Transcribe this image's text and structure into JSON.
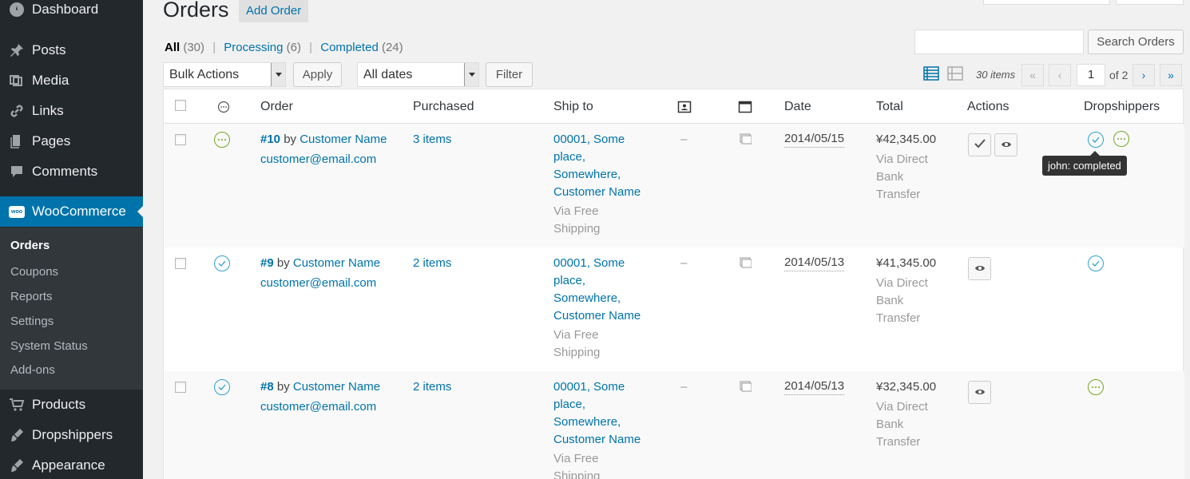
{
  "sidebar": {
    "items": [
      {
        "label": "Dashboard",
        "icon": "dashboard-icon"
      },
      {
        "label": "Posts",
        "icon": "pin-icon"
      },
      {
        "label": "Media",
        "icon": "media-icon"
      },
      {
        "label": "Links",
        "icon": "link-icon"
      },
      {
        "label": "Pages",
        "icon": "pages-icon"
      },
      {
        "label": "Comments",
        "icon": "comment-icon"
      },
      {
        "label": "WooCommerce",
        "icon": "woo-icon"
      },
      {
        "label": "Products",
        "icon": "cart-icon"
      },
      {
        "label": "Dropshippers",
        "icon": "brush-icon"
      },
      {
        "label": "Appearance",
        "icon": "appearance-icon"
      }
    ],
    "submenu": [
      "Orders",
      "Coupons",
      "Reports",
      "Settings",
      "System Status",
      "Add-ons"
    ],
    "woo_badge": "woo"
  },
  "header": {
    "title": "Orders",
    "add_label": "Add Order"
  },
  "views": {
    "all": "All",
    "all_count": "(30)",
    "processing": "Processing",
    "processing_count": "(6)",
    "completed": "Completed",
    "completed_count": "(24)",
    "sep": "|"
  },
  "search": {
    "button": "Search Orders",
    "value": ""
  },
  "filters": {
    "bulk": "Bulk Actions",
    "apply": "Apply",
    "dates": "All dates",
    "filter": "Filter"
  },
  "pagination": {
    "items": "30 items",
    "first": "«",
    "prev": "‹",
    "page": "1",
    "of": "of 2",
    "next": "›",
    "last": "»"
  },
  "columns": {
    "order": "Order",
    "purchased": "Purchased",
    "ship_to": "Ship to",
    "date": "Date",
    "total": "Total",
    "actions": "Actions",
    "dropshippers": "Dropshippers"
  },
  "rows": [
    {
      "number": "#10",
      "by": "by",
      "customer": "Customer Name",
      "email": "customer@email.com",
      "items": "3 items",
      "ship": [
        "00001, Some",
        "place,",
        "Somewhere,",
        "Customer Name"
      ],
      "via_ship": [
        "Via Free",
        "Shipping"
      ],
      "dash": "–",
      "date": "2014/05/15",
      "total": "¥42,345.00",
      "via_pay": [
        "Via Direct",
        "Bank",
        "Transfer"
      ],
      "status": "processing"
    },
    {
      "number": "#9",
      "by": "by",
      "customer": "Customer Name",
      "email": "customer@email.com",
      "items": "2 items",
      "ship": [
        "00001, Some",
        "place,",
        "Somewhere,",
        "Customer Name"
      ],
      "via_ship": [
        "Via Free",
        "Shipping"
      ],
      "dash": "–",
      "date": "2014/05/13",
      "total": "¥41,345.00",
      "via_pay": [
        "Via Direct",
        "Bank",
        "Transfer"
      ],
      "status": "completed"
    },
    {
      "number": "#8",
      "by": "by",
      "customer": "Customer Name",
      "email": "customer@email.com",
      "items": "2 items",
      "ship": [
        "00001, Some",
        "place,",
        "Somewhere,",
        "Customer Name"
      ],
      "via_ship": [
        "Via Free",
        "Shipping"
      ],
      "dash": "–",
      "date": "2014/05/13",
      "total": "¥32,345.00",
      "via_pay": [
        "Via Direct",
        "Bank",
        "Transfer"
      ],
      "status": "completed"
    }
  ],
  "tooltip": "john: completed",
  "colors": {
    "accent": "#0073aa",
    "processing": "#73a724",
    "completed": "#2ea2cc",
    "sidebar": "#23282d"
  }
}
